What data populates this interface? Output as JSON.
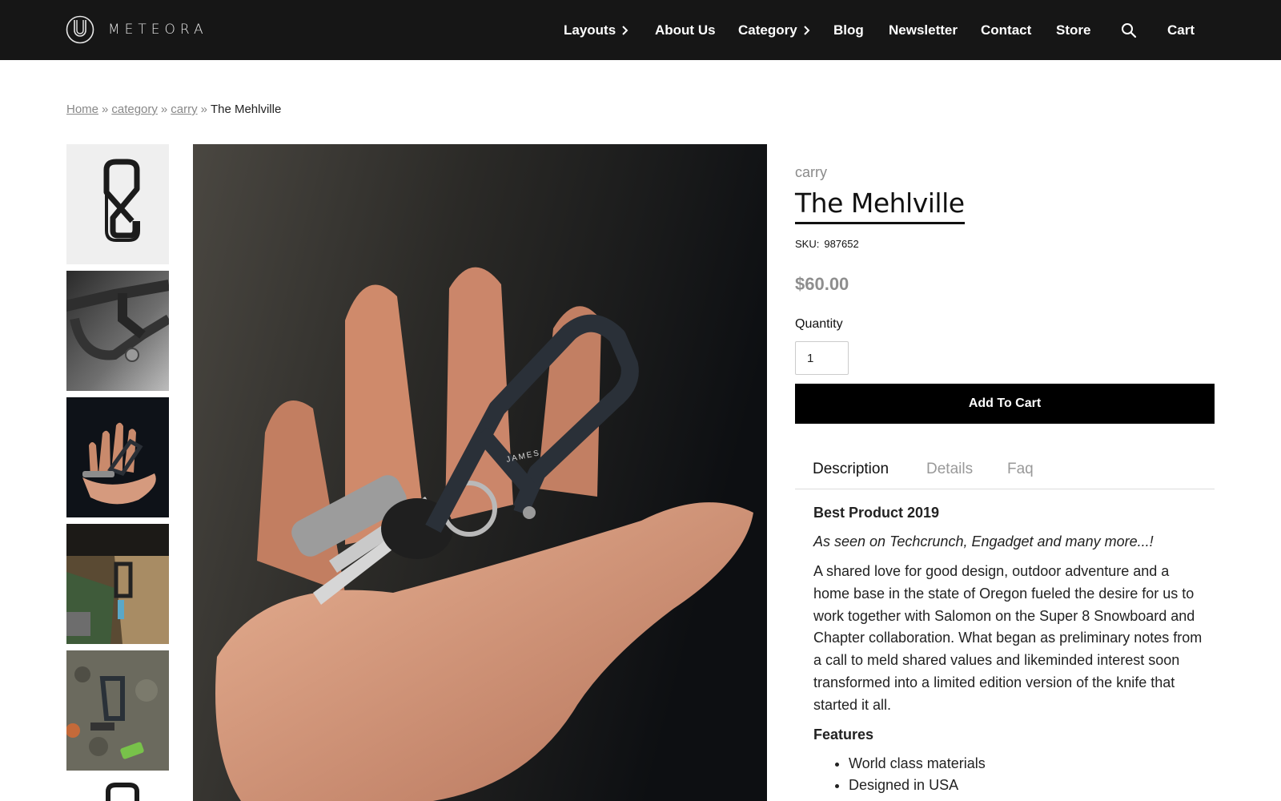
{
  "brand": {
    "name": "METEORA",
    "logo_icon": "meteora-logo-icon"
  },
  "nav": {
    "items": [
      {
        "label": "Layouts",
        "has_chevron": true
      },
      {
        "label": "About Us",
        "has_chevron": false
      },
      {
        "label": "Category",
        "has_chevron": true
      },
      {
        "label": "Blog",
        "has_chevron": false
      },
      {
        "label": "Newsletter",
        "has_chevron": false
      },
      {
        "label": "Contact",
        "has_chevron": false
      },
      {
        "label": "Store",
        "has_chevron": false
      }
    ],
    "search_icon": "search-icon",
    "cart_label": "Cart"
  },
  "breadcrumb": {
    "links": [
      "Home",
      "category",
      "carry"
    ],
    "separator": "»",
    "current": "The Mehlville"
  },
  "product": {
    "category": "carry",
    "title": "The Mehlville",
    "sku_label": "SKU:",
    "sku": "987652",
    "price": "$60.00",
    "quantity_label": "Quantity",
    "quantity_value": "1",
    "add_to_cart_label": "Add To Cart"
  },
  "tabs": [
    {
      "label": "Description",
      "active": true
    },
    {
      "label": "Details",
      "active": false
    },
    {
      "label": "Faq",
      "active": false
    }
  ],
  "description": {
    "heading": "Best Product 2019",
    "tagline": "As seen on Techcrunch, Engadget and many more...!",
    "body": "A shared love for good design, outdoor adventure and a home base in the state of Oregon fueled the desire for us to work together with Salomon on the Super 8 Snowboard and Chapter collaboration. What began as preliminary notes from a call to meld shared values and likeminded interest soon transformed into a limited edition version of the knife that started it all.",
    "features_heading": "Features",
    "features": [
      "World class materials",
      "Designed in USA"
    ]
  },
  "product_image_engraving": "JAMES",
  "colors": {
    "header_bg": "#161616",
    "button_bg": "#000000",
    "price": "#8e8e8e"
  }
}
